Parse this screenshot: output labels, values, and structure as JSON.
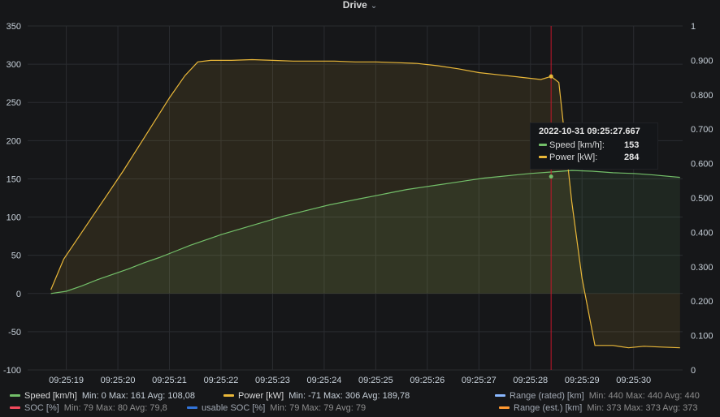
{
  "panel": {
    "title": "Drive",
    "dropdown_icon": "chevron-down-icon"
  },
  "chart_data": {
    "type": "area",
    "x_ticks": [
      "09:25:19",
      "09:25:20",
      "09:25:21",
      "09:25:22",
      "09:25:23",
      "09:25:24",
      "09:25:25",
      "09:25:26",
      "09:25:27",
      "09:25:28",
      "09:25:29",
      "09:25:30"
    ],
    "xlim": [
      "09:25:18.25",
      "09:25:30.95"
    ],
    "y_left": {
      "ticks": [
        "350",
        "300",
        "250",
        "200",
        "150",
        "100",
        "50",
        "0",
        "-50",
        "-100"
      ],
      "lim": [
        -100,
        350
      ]
    },
    "y_right": {
      "ticks": [
        "1",
        "0.900",
        "0.800",
        "0.700",
        "0.600",
        "0.500",
        "0.400",
        "0.300",
        "0.200",
        "0.100",
        "0"
      ],
      "lim": [
        0,
        1
      ]
    },
    "grid": true,
    "crosshair_time": "09:25:28.40",
    "series": [
      {
        "name": "Speed [km/h]",
        "color": "#73bf69",
        "axis": "left",
        "points": [
          [
            "09:25:18.70",
            0
          ],
          [
            "09:25:19.00",
            3
          ],
          [
            "09:25:19.30",
            10
          ],
          [
            "09:25:19.60",
            18
          ],
          [
            "09:25:19.90",
            25
          ],
          [
            "09:25:20.20",
            32
          ],
          [
            "09:25:20.50",
            40
          ],
          [
            "09:25:20.80",
            47
          ],
          [
            "09:25:21.10",
            55
          ],
          [
            "09:25:21.40",
            63
          ],
          [
            "09:25:21.70",
            70
          ],
          [
            "09:25:22.00",
            77
          ],
          [
            "09:25:22.30",
            83
          ],
          [
            "09:25:22.60",
            89
          ],
          [
            "09:25:22.90",
            95
          ],
          [
            "09:25:23.20",
            101
          ],
          [
            "09:25:23.50",
            106
          ],
          [
            "09:25:23.80",
            111
          ],
          [
            "09:25:24.10",
            116
          ],
          [
            "09:25:24.40",
            120
          ],
          [
            "09:25:24.70",
            124
          ],
          [
            "09:25:25.00",
            128
          ],
          [
            "09:25:25.30",
            132
          ],
          [
            "09:25:25.60",
            136
          ],
          [
            "09:25:25.90",
            139
          ],
          [
            "09:25:26.20",
            142
          ],
          [
            "09:25:26.50",
            145
          ],
          [
            "09:25:26.80",
            148
          ],
          [
            "09:25:27.10",
            151
          ],
          [
            "09:25:27.40",
            153
          ],
          [
            "09:25:27.70",
            155
          ],
          [
            "09:25:28.00",
            157
          ],
          [
            "09:25:28.40",
            159
          ],
          [
            "09:25:28.80",
            161
          ],
          [
            "09:25:29.20",
            160
          ],
          [
            "09:25:29.60",
            158
          ],
          [
            "09:25:30.00",
            157
          ],
          [
            "09:25:30.40",
            155
          ],
          [
            "09:25:30.90",
            152
          ]
        ]
      },
      {
        "name": "Power [kW]",
        "color": "#eab839",
        "axis": "left",
        "points": [
          [
            "09:25:18.70",
            5
          ],
          [
            "09:25:18.95",
            45
          ],
          [
            "09:25:19.20",
            70
          ],
          [
            "09:25:19.50",
            100
          ],
          [
            "09:25:19.80",
            130
          ],
          [
            "09:25:20.10",
            160
          ],
          [
            "09:25:20.40",
            192
          ],
          [
            "09:25:20.70",
            224
          ],
          [
            "09:25:21.00",
            256
          ],
          [
            "09:25:21.30",
            285
          ],
          [
            "09:25:21.55",
            303
          ],
          [
            "09:25:21.80",
            305
          ],
          [
            "09:25:22.20",
            305
          ],
          [
            "09:25:22.60",
            306
          ],
          [
            "09:25:23.00",
            305
          ],
          [
            "09:25:23.40",
            304
          ],
          [
            "09:25:23.80",
            304
          ],
          [
            "09:25:24.20",
            304
          ],
          [
            "09:25:24.60",
            303
          ],
          [
            "09:25:25.00",
            303
          ],
          [
            "09:25:25.40",
            302
          ],
          [
            "09:25:25.80",
            301
          ],
          [
            "09:25:26.20",
            298
          ],
          [
            "09:25:26.60",
            294
          ],
          [
            "09:25:27.00",
            289
          ],
          [
            "09:25:27.40",
            286
          ],
          [
            "09:25:27.80",
            283
          ],
          [
            "09:25:28.20",
            280
          ],
          [
            "09:25:28.40",
            284
          ],
          [
            "09:25:28.55",
            276
          ],
          [
            "09:25:28.80",
            120
          ],
          [
            "09:25:29.00",
            20
          ],
          [
            "09:25:29.25",
            -68
          ],
          [
            "09:25:29.60",
            -68
          ],
          [
            "09:25:29.90",
            -71
          ],
          [
            "09:25:30.20",
            -69
          ],
          [
            "09:25:30.50",
            -70
          ],
          [
            "09:25:30.90",
            -71
          ]
        ]
      }
    ],
    "hover_markers": [
      {
        "series": "Speed [km/h]",
        "time": "09:25:28.40",
        "value": 153
      },
      {
        "series": "Power [kW]",
        "time": "09:25:28.40",
        "value": 284
      }
    ]
  },
  "tooltip": {
    "time": "2022-10-31 09:25:27.667",
    "rows": [
      {
        "label": "Speed [km/h]:",
        "value": "153",
        "color": "#73bf69"
      },
      {
        "label": "Power [kW]:",
        "value": "284",
        "color": "#eab839"
      }
    ]
  },
  "legend": {
    "items": [
      {
        "name": "Speed [km/h]",
        "color": "#73bf69",
        "stats": "Min: 0  Max: 161  Avg: 108,08"
      },
      {
        "name": "Power [kW]",
        "color": "#eab839",
        "stats": "Min: -71  Max: 306  Avg: 189,78"
      },
      {
        "name": "Range (rated) [km]",
        "color": "#8ab8ff",
        "stats": "Min: 440  Max: 440  Avg: 440"
      },
      {
        "name": "SOC [%]",
        "color": "#f2495c",
        "stats": "Min: 79  Max: 80  Avg: 79,8"
      },
      {
        "name": "usable SOC [%]",
        "color": "#3274d9",
        "stats": "Min: 79  Max: 79  Avg: 79"
      },
      {
        "name": "Range (est.) [km]",
        "color": "#ff9830",
        "stats": "Min: 373  Max: 373  Avg: 373"
      }
    ]
  },
  "colors": {
    "background": "#161719",
    "grid": "#2a2c30",
    "crosshair": "#c4162a"
  }
}
